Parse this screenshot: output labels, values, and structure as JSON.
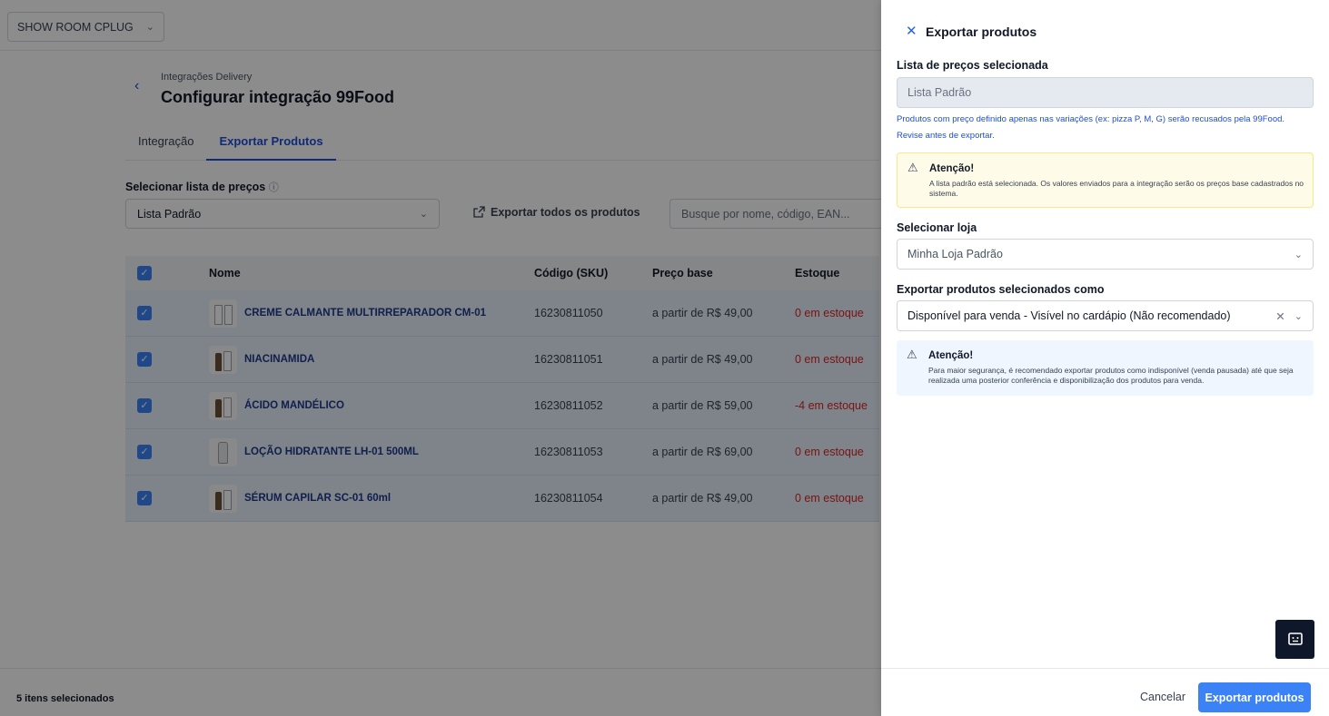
{
  "store_selector": {
    "label": "SHOW ROOM CPLUG"
  },
  "header": {
    "breadcrumb": "Integrações Delivery",
    "title": "Configurar integração 99Food"
  },
  "tabs": [
    {
      "label": "Integração",
      "active": false
    },
    {
      "label": "Exportar Produtos",
      "active": true
    }
  ],
  "filters": {
    "price_list_label": "Selecionar lista de preços",
    "price_list_value": "Lista Padrão",
    "export_all_label": "Exportar todos os produtos",
    "search_placeholder": "Busque por nome, código, EAN..."
  },
  "table": {
    "columns": [
      "Nome",
      "Código (SKU)",
      "Preço base",
      "Estoque"
    ],
    "rows": [
      {
        "name": "CREME CALMANTE MULTIRREPARADOR CM-01",
        "sku": "16230811050",
        "price": "a partir de R$ 49,00",
        "stock": "0 em estoque",
        "checked": true
      },
      {
        "name": "NIACINAMIDA",
        "sku": "16230811051",
        "price": "a partir de R$ 49,00",
        "stock": "0 em estoque",
        "checked": true
      },
      {
        "name": "ÁCIDO MANDÉLICO",
        "sku": "16230811052",
        "price": "a partir de R$ 59,00",
        "stock": "-4 em estoque",
        "checked": true
      },
      {
        "name": "LOÇÃO HIDRATANTE LH-01 500ML",
        "sku": "16230811053",
        "price": "a partir de R$ 69,00",
        "stock": "0 em estoque",
        "checked": true
      },
      {
        "name": "SÉRUM CAPILAR SC-01 60ml",
        "sku": "16230811054",
        "price": "a partir de R$ 49,00",
        "stock": "0 em estoque",
        "checked": true
      }
    ]
  },
  "footer": {
    "selected_count": "5 itens selecionados"
  },
  "drawer": {
    "title": "Exportar produtos",
    "price_list_label": "Lista de preços selecionada",
    "price_list_value": "Lista Padrão",
    "hint_line1": "Produtos com preço definido apenas nas variações (ex: pizza P, M, G) serão recusados pela 99Food.",
    "hint_line2": "Revise antes de exportar.",
    "alert1": {
      "title": "Atenção!",
      "text": "A lista padrão está selecionada. Os valores enviados para a integração serão os preços base cadastrados no sistema."
    },
    "store_label": "Selecionar loja",
    "store_value": "Minha Loja Padrão",
    "export_as_label": "Exportar produtos selecionados como",
    "export_as_value": "Disponível para venda - Visível no cardápio (Não recomendado)",
    "alert2": {
      "title": "Atenção!",
      "text": "Para maior segurança, é recomendado exportar produtos como indisponível (venda pausada) até que seja realizada uma posterior conferência e disponibilização dos produtos para venda."
    },
    "cancel_label": "Cancelar",
    "export_label": "Exportar produtos"
  },
  "colors": {
    "primary": "#3b82f6",
    "link": "#1d4ed8",
    "stock_red": "#dc2626",
    "warning_bg": "#fefce8",
    "info_bg": "#eff6ff"
  }
}
